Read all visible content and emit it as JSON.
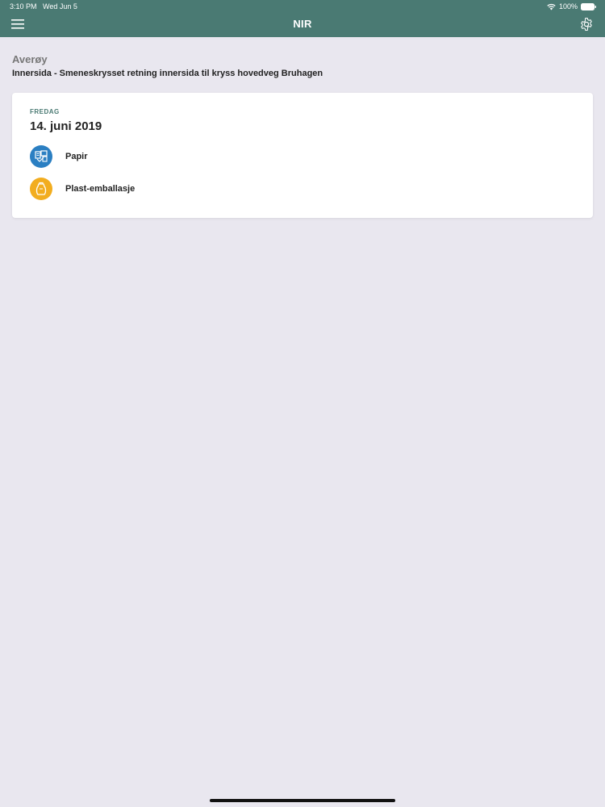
{
  "status_bar": {
    "time": "3:10 PM",
    "date": "Wed Jun 5",
    "battery": "100%"
  },
  "header": {
    "title": "NIR",
    "menu_icon": "hamburger-menu-icon",
    "settings_icon": "gear-icon"
  },
  "location": {
    "municipality": "Averøy",
    "street": "Innersida - Smeneskrysset retning innersida til kryss hovedveg Bruhagen"
  },
  "pickup": {
    "weekday": "FREDAG",
    "date": "14. juni 2019",
    "items": [
      {
        "label": "Papir",
        "icon": "paper-waste-icon",
        "color": "#2b7fc2"
      },
      {
        "label": "Plast-emballasje",
        "icon": "plastic-waste-icon",
        "color": "#f2ad1f"
      }
    ]
  },
  "colors": {
    "header": "#4a7a73",
    "background": "#e9e7ef",
    "card": "#ffffff"
  }
}
